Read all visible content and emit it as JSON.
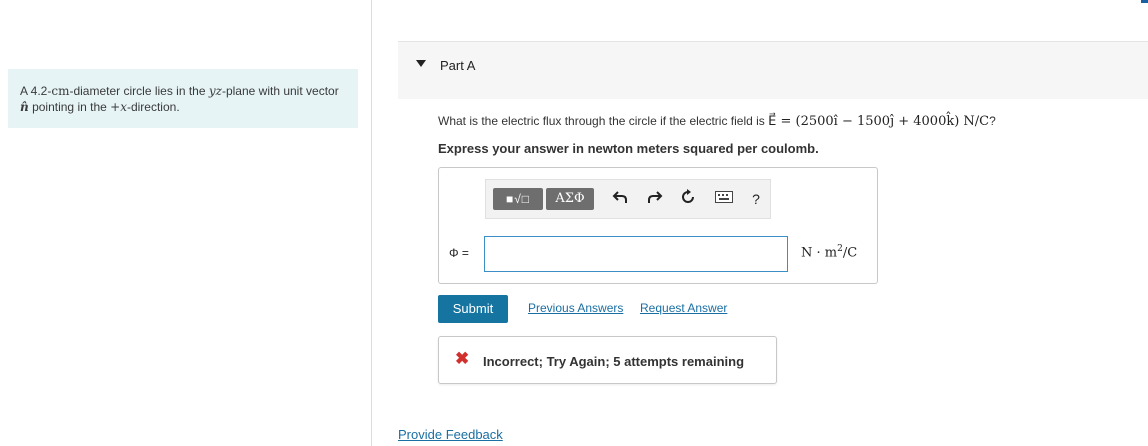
{
  "problem": {
    "text_part1": "A 4.2-",
    "text_math1": "cm",
    "text_part2": "-diameter circle lies in the ",
    "text_math2": "yz",
    "text_part3": "-plane with unit vector ",
    "text_math3": "n̂",
    "text_part4": " pointing in the ",
    "text_math4": "+x",
    "text_part5": "-direction."
  },
  "part": {
    "title": "Part A"
  },
  "question": {
    "prefix": "What is the electric flux through the circle if the electric field is ",
    "formula": "E⃗ = (2500î − 1500ĵ + 4000k̂) N/C",
    "suffix": "?"
  },
  "instructions": "Express your answer in newton meters squared per coulomb.",
  "toolbar": {
    "templates_label": "■√□",
    "greek_label": "ΑΣΦ",
    "help_label": "?"
  },
  "answer": {
    "variable_label": "Φ =",
    "value": "",
    "units_prefix": "N · m",
    "units_exp": "2",
    "units_suffix": "/C"
  },
  "actions": {
    "submit_label": "Submit",
    "previous_answers_label": "Previous Answers",
    "request_answer_label": "Request Answer"
  },
  "feedback": {
    "message": "Incorrect; Try Again; 5 attempts remaining",
    "status_color": "#d0312d"
  },
  "footer": {
    "provide_feedback_label": "Provide Feedback"
  }
}
